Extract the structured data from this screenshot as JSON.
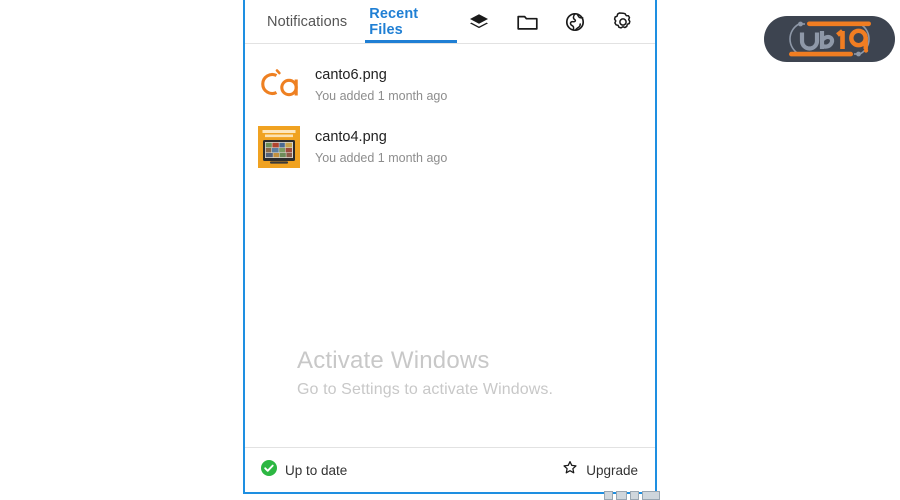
{
  "window": {
    "accent_color": "#1e8fe1",
    "border_color": "#1e8fe1"
  },
  "header": {
    "tabs": [
      {
        "label": "Notifications",
        "active": false,
        "name": "tab-notifications"
      },
      {
        "label": "Recent Files",
        "active": true,
        "name": "tab-recent-files"
      }
    ],
    "active_tab_color": "#1f7fd4",
    "icons": [
      {
        "name": "layers-icon",
        "title": "Layers"
      },
      {
        "name": "folder-icon",
        "title": "Folder"
      },
      {
        "name": "globe-icon",
        "title": "Globe"
      },
      {
        "name": "gear-icon",
        "title": "Settings"
      }
    ]
  },
  "files": [
    {
      "name": "canto6.png",
      "subtitle": "You added 1 month ago",
      "thumb_type": "ca-logo",
      "thumb_color": "#ee8022"
    },
    {
      "name": "canto4.png",
      "subtitle": "You added 1 month ago",
      "thumb_type": "photo-orange",
      "thumb_color": "#f0a221"
    }
  ],
  "watermark": {
    "title": "Activate Windows",
    "subtitle": "Go to Settings to activate Windows.",
    "color": "#c8c8c8"
  },
  "footer": {
    "status_label": "Up to date",
    "status_icon": "check-circle-icon",
    "status_color": "#2cb742",
    "upgrade_label": "Upgrade",
    "upgrade_icon": "star-icon"
  },
  "logo": {
    "text_left": "UR",
    "text_right": "19",
    "body_color": "#3d4450",
    "accent_color": "#f07d22",
    "letter_color": "#8e98a8"
  }
}
